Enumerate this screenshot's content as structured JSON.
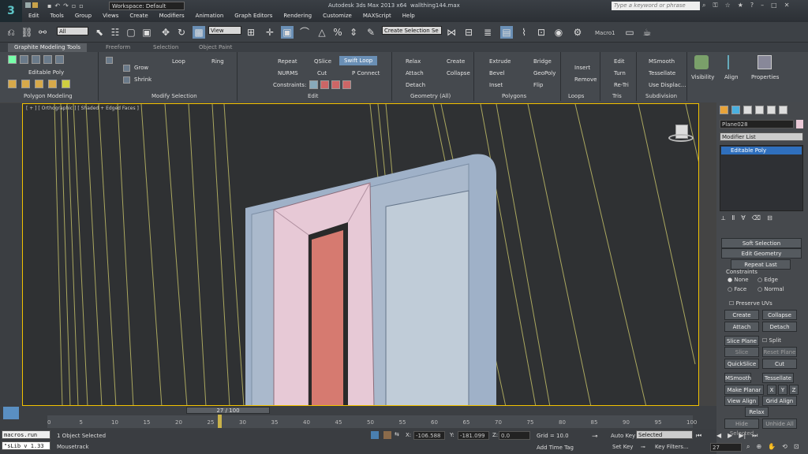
{
  "title_bar": {
    "workspace": "Workspace: Default",
    "app_title": "Autodesk 3ds Max  2013 x64",
    "file_name": "wallthing144.max",
    "search_placeholder": "Type a keyword or phrase"
  },
  "menu": [
    "Edit",
    "Tools",
    "Group",
    "Views",
    "Create",
    "Modifiers",
    "Animation",
    "Graph Editors",
    "Rendering",
    "Customize",
    "MAXScript",
    "Help"
  ],
  "main_toolbar": {
    "filter_select": "All",
    "ref_coord": "View",
    "named_selection": "Create Selection Se",
    "macro": "Macro1"
  },
  "ribbon": {
    "tabs": [
      "Graphite Modeling Tools",
      "Freeform",
      "Selection",
      "Object Paint"
    ],
    "active_tab": "Graphite Modeling Tools",
    "polygon_modeling": {
      "label": "Editable Poly",
      "panel": "Polygon Modeling"
    },
    "modify_selection": {
      "grow": "Grow",
      "shrink": "Shrink",
      "loop": "Loop",
      "ring": "Ring",
      "panel": "Modify Selection"
    },
    "edit": {
      "repeat": "Repeat",
      "qslice": "QSlice",
      "swift_loop": "Swift Loop",
      "nurms": "NURMS",
      "cut": "Cut",
      "p_connect": "P Connect",
      "constraints": "Constraints:",
      "panel": "Edit"
    },
    "geometry": {
      "relax": "Relax",
      "create": "Create",
      "attach": "Attach",
      "collapse": "Collapse",
      "detach": "Detach",
      "panel": "Geometry (All)"
    },
    "polygons": {
      "extrude": "Extrude",
      "bridge": "Bridge",
      "bevel": "Bevel",
      "geopoly": "GeoPoly",
      "inset": "Inset",
      "flip": "Flip",
      "panel": "Polygons"
    },
    "loops": {
      "insert": "Insert",
      "remove": "Remove",
      "panel": "Loops"
    },
    "tris": {
      "edit": "Edit",
      "turn": "Turn",
      "retri": "Re-Tri",
      "panel": "Tris"
    },
    "subdivision": {
      "msmooth": "MSmooth",
      "tessellate": "Tessellate",
      "use_displac": "Use Displac...",
      "panel": "Subdivision"
    },
    "visibility": "Visibility",
    "align": "Align",
    "properties": "Properties"
  },
  "viewport": {
    "label": "[ + ] [ Orthographic ] [ Shaded + Edged Faces ]"
  },
  "command_panel": {
    "object_name": "Plane028",
    "modifier_list": "Modifier List",
    "stack_item": "Editable Poly",
    "rollouts": {
      "soft_selection": "Soft Selection",
      "edit_geometry": "Edit Geometry"
    },
    "repeat_last": "Repeat Last",
    "constraints_label": "Constraints",
    "constraint_options": [
      "None",
      "Edge",
      "Face",
      "Normal"
    ],
    "preserve_uvs": "Preserve UVs",
    "buttons": [
      [
        "Create",
        "Collapse"
      ],
      [
        "Attach",
        "Detach"
      ]
    ],
    "slice_plane": "Slice Plane",
    "split": "Split",
    "slice": "Slice",
    "reset_plane": "Reset Plane",
    "quickslice": "QuickSlice",
    "cut": "Cut",
    "msmooth": "MSmooth",
    "tessellate": "Tessellate",
    "make_planar": "Make Planar",
    "x": "X",
    "y": "Y",
    "z": "Z",
    "view_align": "View Align",
    "grid_align": "Grid Align",
    "relax": "Relax",
    "hide_selected": "Hide Selected",
    "unhide_all": "Unhide All"
  },
  "timeline": {
    "frame": "27 / 100",
    "ticks": [
      "0",
      "5",
      "10",
      "15",
      "20",
      "25",
      "30",
      "35",
      "40",
      "45",
      "50",
      "55",
      "60",
      "65",
      "70",
      "75",
      "80",
      "85",
      "90",
      "95",
      "100"
    ],
    "current": 27,
    "total": 100
  },
  "status": {
    "macro_run": "macros.run",
    "lib": "\"sLib v 1.33",
    "selected": "1 Object Selected",
    "mousetrack": "Mousetrack",
    "x_label": "X:",
    "x_value": "-106.588",
    "y_label": "Y:",
    "y_value": "-181.099",
    "z_label": "Z:",
    "z_value": "0.0",
    "grid": "Grid = 10.0",
    "auto_key": "Auto Key",
    "key_mode": "Selected",
    "set_key": "Set Key",
    "key_filters": "Key Filters...",
    "add_time_tag": "Add Time Tag",
    "frame_field": "27"
  }
}
